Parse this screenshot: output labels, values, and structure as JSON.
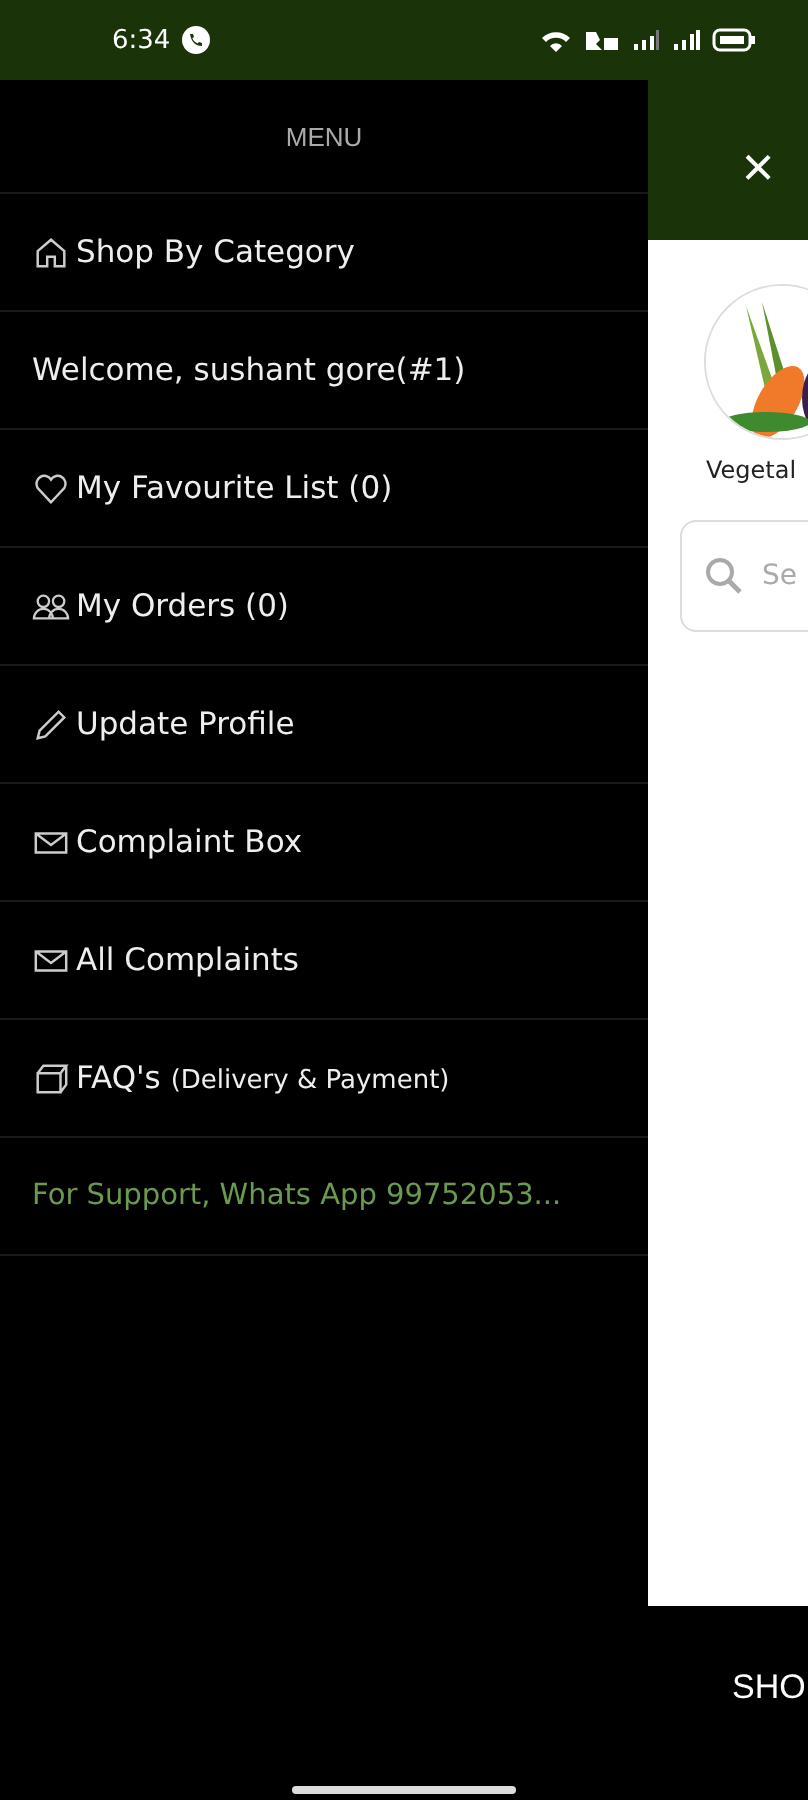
{
  "status_bar": {
    "time": "6:34"
  },
  "drawer": {
    "title": "MENU",
    "items": [
      {
        "kind": "home",
        "label": "Shop By Category"
      },
      {
        "kind": "plain",
        "label": "Welcome, sushant gore(#1)"
      },
      {
        "kind": "heart",
        "label": "My Favourite List (0)"
      },
      {
        "kind": "orders",
        "label": "My Orders (0)"
      },
      {
        "kind": "pencil",
        "label": "Update Profile"
      },
      {
        "kind": "mail",
        "label": "Complaint Box"
      },
      {
        "kind": "mail",
        "label": "All Complaints"
      },
      {
        "kind": "box",
        "label": "FAQ's",
        "note": "(Delivery & Payment)"
      },
      {
        "kind": "support",
        "label": "For Support, Whats App 99752053..."
      }
    ]
  },
  "behind": {
    "close": "×",
    "category": {
      "label": "Vegetal"
    },
    "search": {
      "placeholder": "Se"
    },
    "bottom_text": "SHO"
  }
}
